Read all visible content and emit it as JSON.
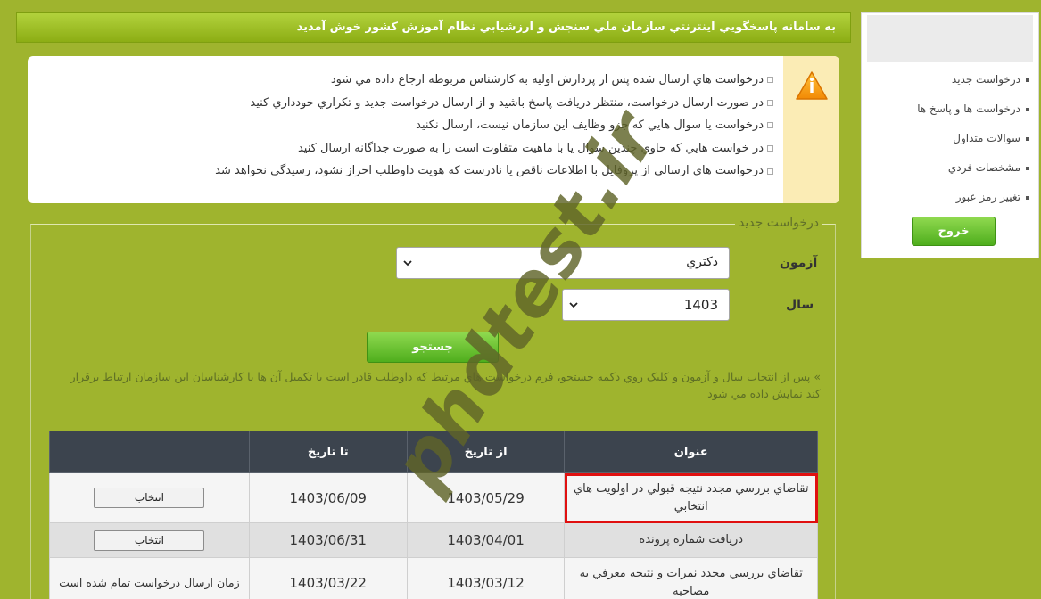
{
  "header": {
    "title": "به سامانه پاسخگويي اينترنتي سازمان ملي سنجش و ارزشيابي نظام آموزش کشور خوش آمديد"
  },
  "sidebar": {
    "items": [
      {
        "label": "درخواست جديد"
      },
      {
        "label": "درخواست ها و پاسخ ها"
      },
      {
        "label": "سوالات متداول"
      },
      {
        "label": "مشخصات فردي"
      },
      {
        "label": "تغيير رمز عبور"
      }
    ],
    "logout_label": "خروج"
  },
  "notice": {
    "items": [
      "درخواست هاي ارسال شده پس از پردازش اوليه به کارشناس مربوطه ارجاع داده مي شود",
      "در صورت ارسال درخواست، منتظر دريافت پاسخ باشيد و از ارسال درخواست جديد و تکراري خودداري کنيد",
      "درخواست يا سوال هايي که جزو وظايف اين سازمان نيست، ارسال نکنيد",
      "در خواست هايي که حاوي چندين سوال يا با ماهيت متفاوت است را به صورت جداگانه ارسال کنيد",
      "درخواست هاي ارسالي از پروفايل با اطلاعات ناقص يا نادرست که هويت داوطلب احراز نشود، رسيدگي نخواهد شد"
    ]
  },
  "form": {
    "legend": "درخواست جديد",
    "exam_label": "آزمون",
    "exam_value": "دکتري",
    "year_label": "سال",
    "year_value": "1403",
    "search_label": "جستجو",
    "hint": "» پس از انتخاب سال و آزمون و کليک روي دکمه جستجو، فرم درخواست هاي مرتبط که داوطلب قادر است با تکميل آن ها با کارشناسان اين سازمان ارتباط برقرار کند نمايش داده مي شود"
  },
  "table": {
    "headers": {
      "title": "عنوان",
      "from": "از تاريخ",
      "to": "تا تاريخ",
      "action": ""
    },
    "rows": [
      {
        "title": "تقاضاي بررسي مجدد نتيجه قبولي در اولويت هاي انتخابي",
        "from": "1403/05/29",
        "to": "1403/06/09",
        "action": "انتخاب"
      },
      {
        "title": "دريافت شماره پرونده",
        "from": "1403/04/01",
        "to": "1403/06/31",
        "action": "انتخاب"
      },
      {
        "title": "تقاضاي بررسي مجدد نمرات و نتيجه معرفي به مصاحبه",
        "from": "1403/03/12",
        "to": "1403/03/22",
        "action": "زمان ارسال درخواست تمام شده است"
      }
    ]
  },
  "watermark": {
    "text": "phdtest.ir"
  },
  "icons": {
    "warning": "warning-icon",
    "select_arrow": "chevron-down-icon"
  },
  "colors": {
    "background": "#9fb42e",
    "header": "#8cad14",
    "button": "#4fae1d",
    "highlight": "#e01010",
    "table_header": "#3c444e"
  }
}
